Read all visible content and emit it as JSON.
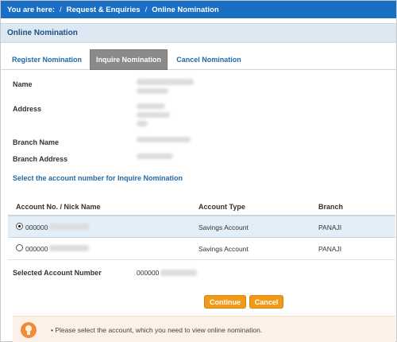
{
  "breadcrumb": {
    "prefix": "You are here:",
    "separator": "/",
    "items": [
      "Request & Enquiries",
      "Online Nomination"
    ]
  },
  "panel": {
    "title": "Online Nomination"
  },
  "tabs": [
    {
      "label": "Register Nomination",
      "active": false
    },
    {
      "label": "Inquire Nomination",
      "active": true
    },
    {
      "label": "Cancel Nomination",
      "active": false
    }
  ],
  "fields": {
    "name_label": "Name",
    "address_label": "Address",
    "branch_name_label": "Branch Name",
    "branch_address_label": "Branch Address"
  },
  "select_prompt": "Select the account number for Inquire Nomination",
  "table": {
    "headers": [
      "Account No. / Nick Name",
      "Account Type",
      "Branch"
    ],
    "rows": [
      {
        "account": "000000",
        "type": "Savings Account",
        "branch": "PANAJI",
        "selected": true
      },
      {
        "account": "000000",
        "type": "Savings Account",
        "branch": "PANAJI",
        "selected": false
      }
    ]
  },
  "selected_account": {
    "label": "Selected Account Number",
    "value": "000000"
  },
  "buttons": {
    "continue": "Continue",
    "cancel": "Cancel"
  },
  "notice": {
    "icon": "lightbulb-icon",
    "text": "Please select the account, which you need to view online nomination."
  },
  "colors": {
    "breadcrumb_bg": "#1a6fc4",
    "panel_bg": "#dde8f2",
    "active_tab": "#8a8a8a",
    "accent_button": "#f29a18",
    "notice_bg": "#fdf1e7"
  }
}
